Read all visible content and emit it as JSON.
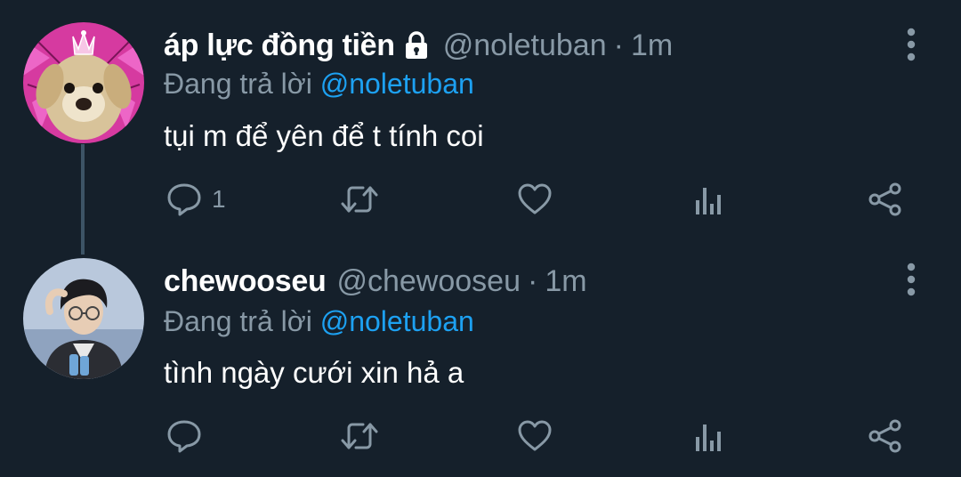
{
  "tweets": [
    {
      "display_name": "áp lực đồng tiền",
      "protected_icon": "lock-icon",
      "handle": "@noletuban",
      "separator": "·",
      "time": "1m",
      "replying_prefix": "Đang trả lời",
      "replying_to": "@noletuban",
      "text": "tụi m để yên để t tính coi",
      "reply_count": "1",
      "avatar_icon": "puppy-with-tiara-avatar"
    },
    {
      "display_name": "chewooseu",
      "handle": "@chewooseu",
      "separator": "·",
      "time": "1m",
      "replying_prefix": "Đang trả lời",
      "replying_to": "@noletuban",
      "text": "tình ngày cưới xin hả a",
      "reply_count": "",
      "avatar_icon": "person-photo-avatar"
    }
  ],
  "colors": {
    "background": "#15202b",
    "text": "#ffffff",
    "secondary": "#8899a6",
    "link": "#1da1f2",
    "thread_line": "#3d5466"
  }
}
